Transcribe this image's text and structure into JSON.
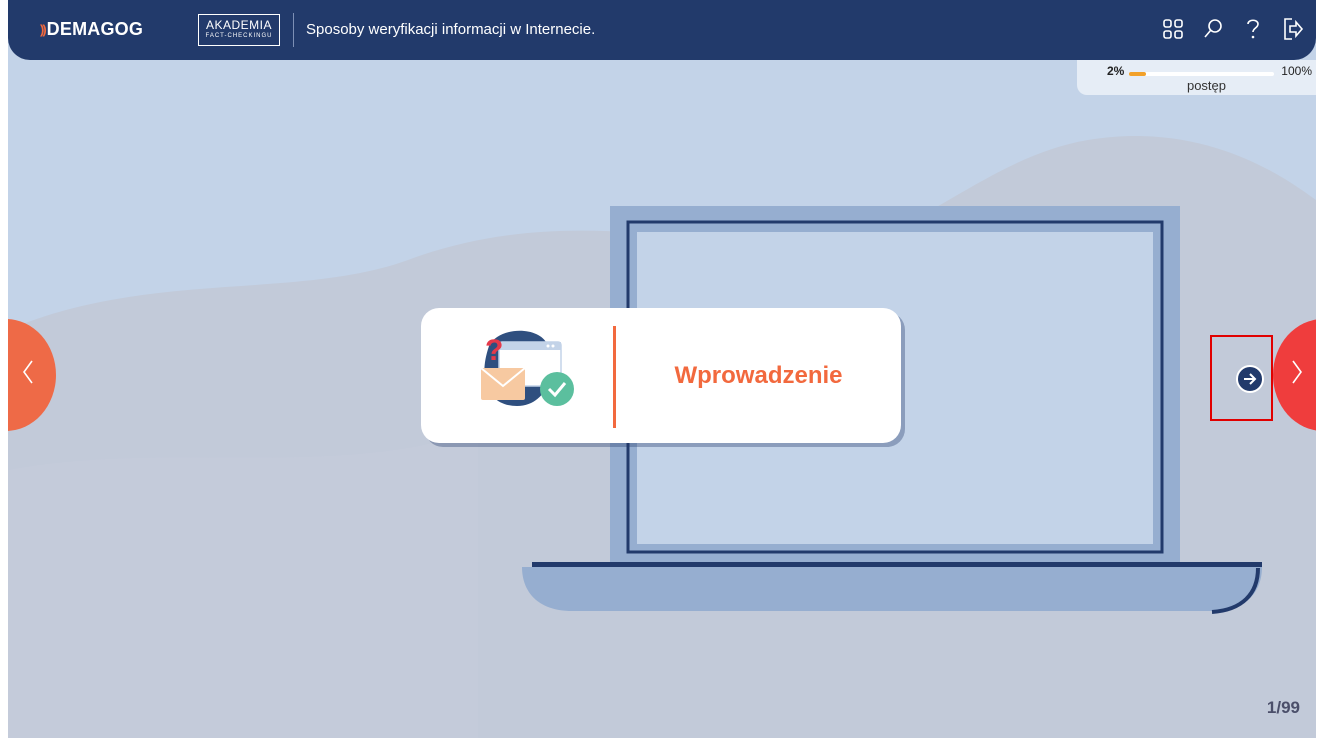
{
  "header": {
    "brand": "DEMAGOG",
    "brand_waves": "))",
    "academy_main": "AKADEMIA",
    "academy_sub": "FACT-CHECKINGU",
    "course_title": "Sposoby weryfikacji informacji w Internecie.",
    "icons": [
      "grid-icon",
      "search-icon",
      "help-icon",
      "exit-icon"
    ]
  },
  "progress": {
    "start_label": "2%",
    "end_label": "100%",
    "caption": "postęp",
    "value_percent": 2
  },
  "section": {
    "title": "Wprowadzenie"
  },
  "navigation": {
    "prev_icon": "chevron-left-icon",
    "next_icon": "chevron-right-icon",
    "next_hint_icon": "arrow-right-circle-icon"
  },
  "page_counter": "1/99",
  "colors": {
    "navy": "#223a6b",
    "accent": "#f2693e",
    "background": "#c3d3e8",
    "next_button": "#ef3d3d",
    "progress_fill": "#f2a12a",
    "highlight": "#e10000"
  }
}
